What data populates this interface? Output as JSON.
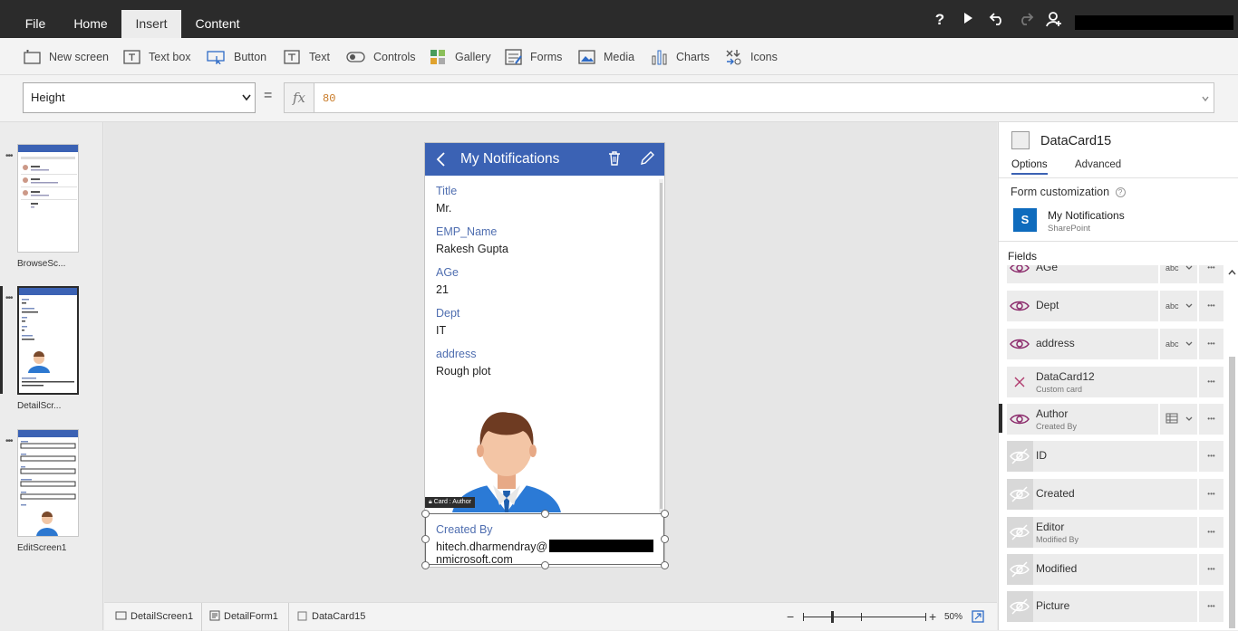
{
  "top_menu": {
    "tabs": [
      {
        "label": "File"
      },
      {
        "label": "Home"
      },
      {
        "label": "Insert"
      },
      {
        "label": "Content"
      }
    ],
    "active_tab": "Insert",
    "icons": [
      "help-icon",
      "play-icon",
      "undo-icon",
      "redo-icon",
      "user-add-icon"
    ]
  },
  "ribbon": {
    "new_screen": "New screen",
    "text_box": "Text box",
    "button": "Button",
    "text": "Text",
    "controls": "Controls",
    "gallery": "Gallery",
    "forms": "Forms",
    "media": "Media",
    "charts": "Charts",
    "icons": "Icons"
  },
  "formula_bar": {
    "property": "Height",
    "equals": "=",
    "fx": "fx",
    "formula": "80"
  },
  "screens": [
    {
      "label": "BrowseSc..."
    },
    {
      "label": "DetailScr..."
    },
    {
      "label": "EditScreen1"
    }
  ],
  "app_screen": {
    "title": "My Notifications",
    "fields": [
      {
        "label": "Title",
        "value": "Mr."
      },
      {
        "label": "EMP_Name",
        "value": "Rakesh Gupta"
      },
      {
        "label": "AGe",
        "value": "21"
      },
      {
        "label": "Dept",
        "value": "IT"
      },
      {
        "label": "address",
        "value": "Rough plot"
      }
    ],
    "card_tag": "Card : Author",
    "created_by_label": "Created By",
    "created_by_value_1": "hitech.dharmendray@",
    "created_by_value_2": "nmicrosoft.com"
  },
  "breadcrumb": {
    "screen": "DetailScreen1",
    "form": "DetailForm1",
    "card": "DataCard15"
  },
  "zoom": {
    "minus": "−",
    "plus": "+",
    "percent": "50%",
    "level": 0.5
  },
  "right_panel": {
    "title": "DataCard15",
    "tabs": {
      "options": "Options",
      "advanced": "Advanced"
    },
    "form_customization": "Form customization",
    "source_name": "My Notifications",
    "source_type": "SharePoint",
    "fields_label": "Fields",
    "fields": [
      {
        "name": "AGe",
        "sub": "",
        "type": "abc",
        "visible": true
      },
      {
        "name": "Dept",
        "sub": "",
        "type": "abc",
        "visible": true
      },
      {
        "name": "address",
        "sub": "",
        "type": "abc",
        "visible": true
      },
      {
        "name": "DataCard12",
        "sub": "Custom card",
        "type": "",
        "visible": true
      },
      {
        "name": "Author",
        "sub": "Created By",
        "type": "grid",
        "visible": true
      },
      {
        "name": "ID",
        "sub": "",
        "type": "",
        "visible": false
      },
      {
        "name": "Created",
        "sub": "",
        "type": "",
        "visible": false
      },
      {
        "name": "Editor",
        "sub": "Modified By",
        "type": "",
        "visible": false
      },
      {
        "name": "Modified",
        "sub": "",
        "type": "",
        "visible": false
      },
      {
        "name": "Picture",
        "sub": "",
        "type": "",
        "visible": false
      }
    ]
  },
  "colors": {
    "header_blue": "#3b62b4",
    "label_blue": "#4f6eb0",
    "top_bar": "#2b2b2b",
    "eye_purple": "#8b2a6b",
    "sharepoint_blue": "#0e6bbd"
  }
}
